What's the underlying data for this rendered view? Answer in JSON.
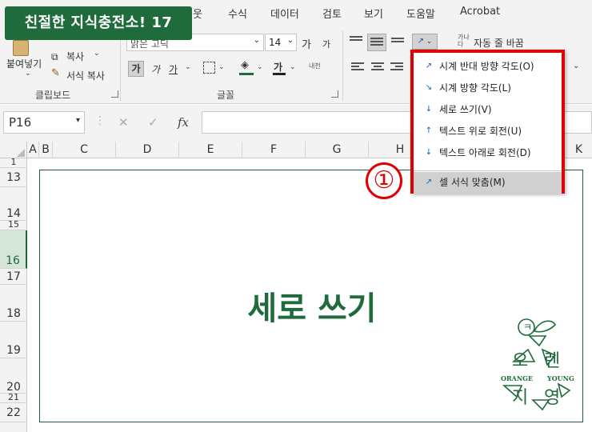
{
  "banner": {
    "title": "친절한 지식충전소! 17"
  },
  "menu_tabs": [
    "웃",
    "수식",
    "데이터",
    "검토",
    "보기",
    "도움말",
    "Acrobat"
  ],
  "clipboard": {
    "paste_label": "붙여넣기",
    "copy_label": "복사",
    "format_painter_label": "서식 복사",
    "group_label": "클립보드"
  },
  "font": {
    "name_value": "맑은 고딕",
    "size_value": "14",
    "grow_label": "가",
    "shrink_label": "가",
    "bold_label": "가",
    "italic_label": "가",
    "underline_label": "가",
    "color_label": "가",
    "phonetic_label": "내천",
    "group_label": "글꼴"
  },
  "alignment": {
    "wrap_label": "자동 줄 바꿈"
  },
  "formula_bar": {
    "name_box": "P16",
    "cancel": "✕",
    "enter": "✓",
    "fx": "fx"
  },
  "columns": [
    "A",
    "B",
    "C",
    "D",
    "E",
    "F",
    "G",
    "H",
    "K"
  ],
  "rows": [
    "1",
    "13",
    "14",
    "15",
    "16",
    "17",
    "18",
    "19",
    "20",
    "21",
    "22"
  ],
  "textbox": {
    "text": "세로 쓰기"
  },
  "orientation_menu": {
    "items": [
      {
        "label": "시계 반대 방향 각도(O)"
      },
      {
        "label": "시계 방향 각도(L)"
      },
      {
        "label": "세로 쓰기(V)"
      },
      {
        "label": "텍스트 위로 회전(U)"
      },
      {
        "label": "텍스트 아래로 회전(D)"
      }
    ],
    "format_item": "셀 서식 맞춤(M)"
  },
  "step_marker": "①",
  "logo": {
    "top_letter": "ㅋ",
    "char_1": "오",
    "char_2": "렌",
    "char_3": "지",
    "char_4": "영",
    "word_left": "ORANGE",
    "word_right": "YOUNG"
  },
  "colors": {
    "brand_green": "#1f6b3c",
    "highlight_red": "#e00000"
  }
}
